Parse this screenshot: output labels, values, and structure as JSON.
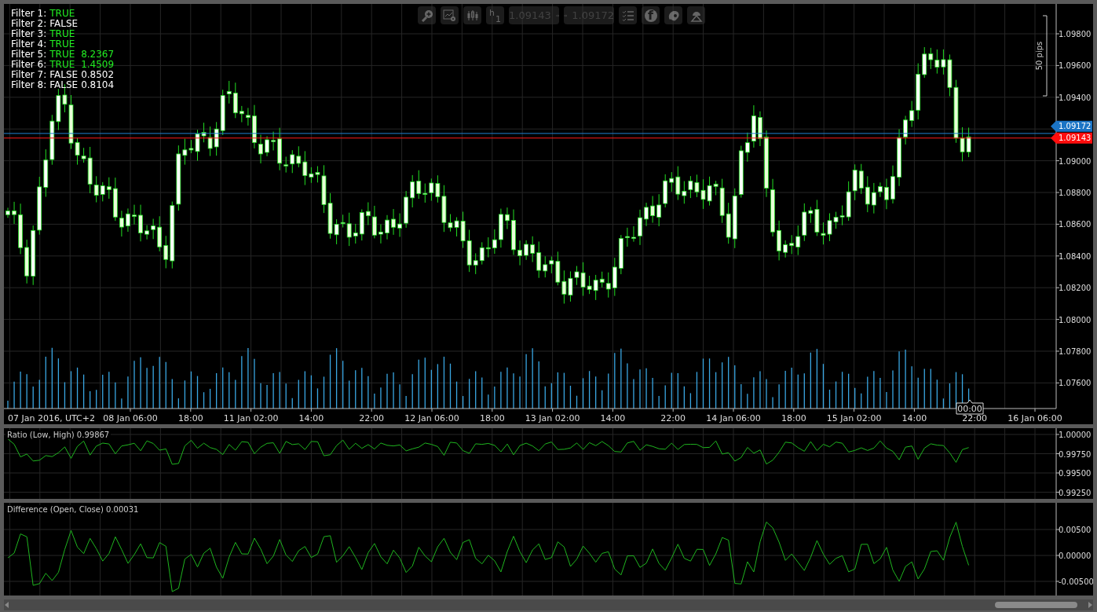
{
  "filters": [
    {
      "label": "Filter 1:",
      "value": "TRUE",
      "passed": true
    },
    {
      "label": "Filter 2:",
      "value": "FALSE",
      "passed": false
    },
    {
      "label": "Filter 3:",
      "value": "TRUE",
      "passed": true
    },
    {
      "label": "Filter 4:",
      "value": "TRUE",
      "passed": true
    },
    {
      "label": "Filter 5:",
      "value": "TRUE",
      "reading": "8.2367",
      "passed": true
    },
    {
      "label": "Filter 6:",
      "value": "TRUE",
      "reading": "1.4509",
      "passed": true
    },
    {
      "label": "Filter 7:",
      "value": "FALSE",
      "reading": "0.8502",
      "passed": false
    },
    {
      "label": "Filter 8:",
      "value": "FALSE",
      "reading": "0.8104",
      "passed": false
    }
  ],
  "toolbar": {
    "timeframe_letter": "h",
    "timeframe_number": "1",
    "sell_price": "1.09143",
    "buy_price": "1.09172",
    "share_letter": "f"
  },
  "price_pane": {
    "scale_label": "50 pips",
    "price_axis": [
      "1.09800",
      "1.09600",
      "1.09400",
      "1.09000",
      "1.08800",
      "1.08600",
      "1.08400",
      "1.08200",
      "1.08000",
      "1.07800",
      "1.07600"
    ],
    "ask_tag": "1.09172",
    "bid_tag": "1.09143",
    "time_axis": [
      "07 Jan 2016, UTC+2",
      "08 Jan 06:00",
      "18:00",
      "11 Jan 02:00",
      "14:00",
      "22:00",
      "12 Jan 06:00",
      "18:00",
      "13 Jan 02:00",
      "14:00",
      "22:00",
      "14 Jan 06:00",
      "18:00",
      "15 Jan 02:00",
      "14:00",
      "22:00",
      "16 Jan 06:00"
    ],
    "cursor_time": "00:00"
  },
  "indicators": [
    {
      "kind": "ratio",
      "title": "Ratio (Low, High) 0.99867",
      "axis": [
        "1.00000",
        "0.99750",
        "0.99500",
        "0.99250"
      ]
    },
    {
      "kind": "difference",
      "title": "Difference (Open, Close) 0.00031",
      "axis": [
        "0.00500",
        "0.00000",
        "-0.00500"
      ]
    }
  ]
}
